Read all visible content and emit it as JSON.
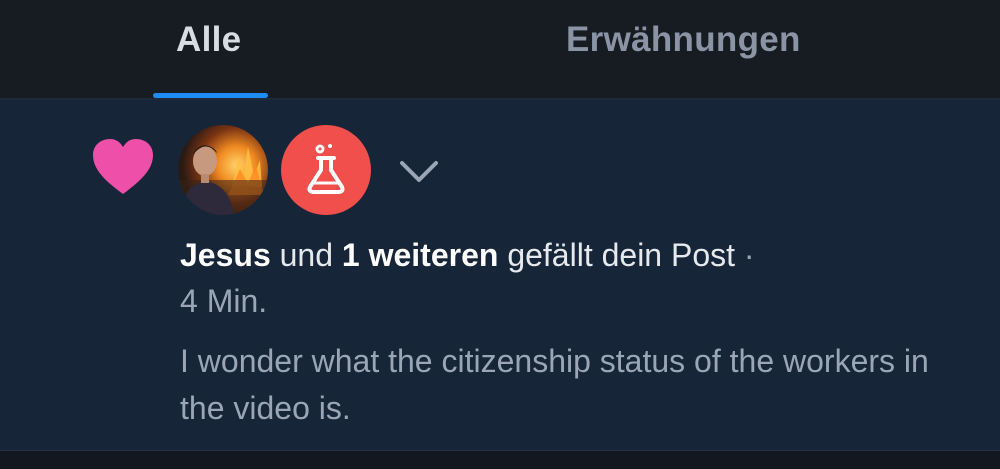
{
  "tabs": {
    "all_label": "Alle",
    "mentions_label": "Erwähnungen"
  },
  "notification": {
    "actor_name": "Jesus",
    "connector": "und",
    "others_count_label": "1 weiteren",
    "action_text": "gefällt dein Post",
    "separator": "·",
    "time": "4 Min.",
    "post_excerpt": "I wonder what the citizenship status of the workers in the video is."
  },
  "icons": {
    "reaction": "heart-icon",
    "feed": "flask-icon",
    "expand": "chevron-down-icon"
  },
  "colors": {
    "accent": "#1d8bf1",
    "heart": "#ee4fa9",
    "feed_badge": "#f04f4c",
    "notification_bg": "#172538"
  }
}
